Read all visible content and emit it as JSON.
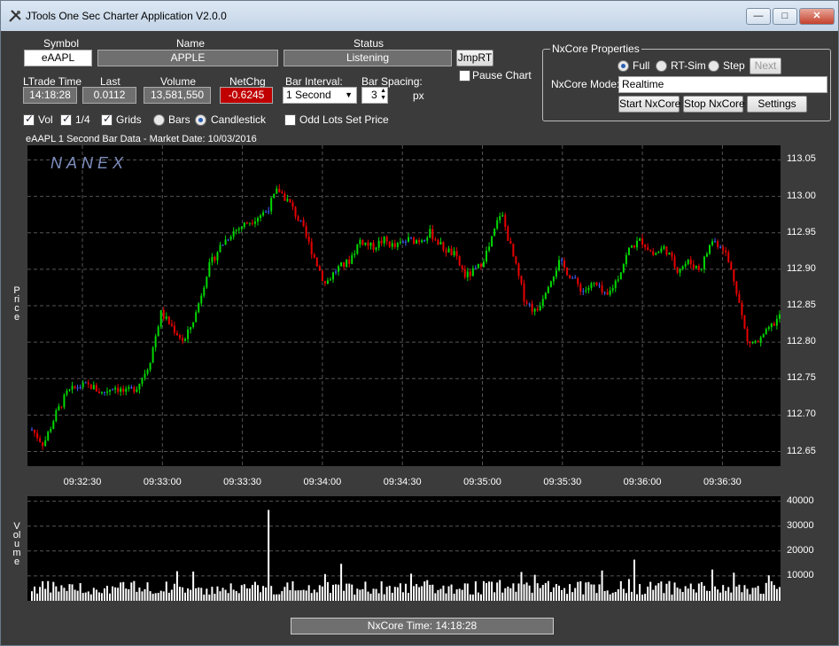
{
  "window": {
    "title": "JTools One Sec Charter Application V2.0.0"
  },
  "header": {
    "symbol_label": "Symbol",
    "symbol_value": "eAAPL",
    "name_label": "Name",
    "name_value": "APPLE",
    "status_label": "Status",
    "status_value": "Listening",
    "jmprt_label": "JmpRT",
    "pause_label": "Pause Chart",
    "ltrade_label": "LTrade Time",
    "ltrade_value": "14:18:28",
    "last_label": "Last",
    "last_value": "0.0112",
    "volume_label": "Volume",
    "volume_value": "13,581,550",
    "netchg_label": "NetChg",
    "netchg_value": "-0.6245",
    "interval_label": "Bar Interval:",
    "interval_value": "1 Second",
    "spacing_label": "Bar Spacing:",
    "spacing_value": "3",
    "spacing_unit": "px"
  },
  "options": {
    "vol": "Vol",
    "quarter": "1/4",
    "grids": "Grids",
    "bars": "Bars",
    "candlestick": "Candlestick",
    "oddlots": "Odd Lots Set Price"
  },
  "nxcore": {
    "title": "NxCore Properties",
    "full": "Full",
    "rtsim": "RT-Sim",
    "step": "Step",
    "next": "Next",
    "mode_label": "NxCore Mode:",
    "mode_value": "Realtime",
    "start": "Start NxCore",
    "stop": "Stop NxCore",
    "settings": "Settings"
  },
  "chart_caption": "eAAPL    1 Second Bar Data - Market Date: 10/03/2016",
  "watermark": "NANEX",
  "price_axis_label": "Price",
  "volume_axis_label": "Volume",
  "status_bar": "NxCore Time: 14:18:28",
  "colors": {
    "up": "#00d800",
    "down": "#e80000",
    "doji": "#4060ff",
    "volume": "#ffffff",
    "background": "#000000",
    "price_negative": "#c00000"
  },
  "chart_data": [
    {
      "type": "candlestick",
      "title": "eAAPL 1 Second Bar Data - Market Date: 10/03/2016",
      "ylabel": "Price",
      "ylim": [
        112.63,
        113.07
      ],
      "yticks": [
        "113.05",
        "113.00",
        "112.95",
        "112.90",
        "112.85",
        "112.80",
        "112.75",
        "112.70",
        "112.65"
      ],
      "xticks": [
        "09:32:30",
        "09:33:00",
        "09:33:30",
        "09:34:00",
        "09:34:30",
        "09:35:00",
        "09:35:30",
        "09:36:00",
        "09:36:30"
      ],
      "grid": true,
      "path": [
        112.68,
        112.66,
        112.7,
        112.73,
        112.74,
        112.74,
        112.73,
        112.74,
        112.73,
        112.74,
        112.77,
        112.84,
        112.82,
        112.8,
        112.84,
        112.9,
        112.93,
        112.95,
        112.96,
        112.97,
        112.98,
        113.01,
        112.99,
        112.96,
        112.92,
        112.88,
        112.9,
        112.91,
        112.94,
        112.93,
        112.94,
        112.93,
        112.94,
        112.94,
        112.95,
        112.93,
        112.92,
        112.89,
        112.9,
        112.93,
        112.98,
        112.92,
        112.86,
        112.84,
        112.88,
        112.91,
        112.89,
        112.87,
        112.88,
        112.86,
        112.89,
        112.93,
        112.94,
        112.92,
        112.93,
        112.9,
        112.91,
        112.9,
        112.94,
        112.93,
        112.88,
        112.8,
        112.8,
        112.82,
        112.84
      ]
    },
    {
      "type": "bar",
      "ylabel": "Volume",
      "ylim": [
        0,
        42000
      ],
      "yticks": [
        "40000",
        "30000",
        "20000",
        "10000"
      ],
      "max_bar_value": 36500
    }
  ]
}
